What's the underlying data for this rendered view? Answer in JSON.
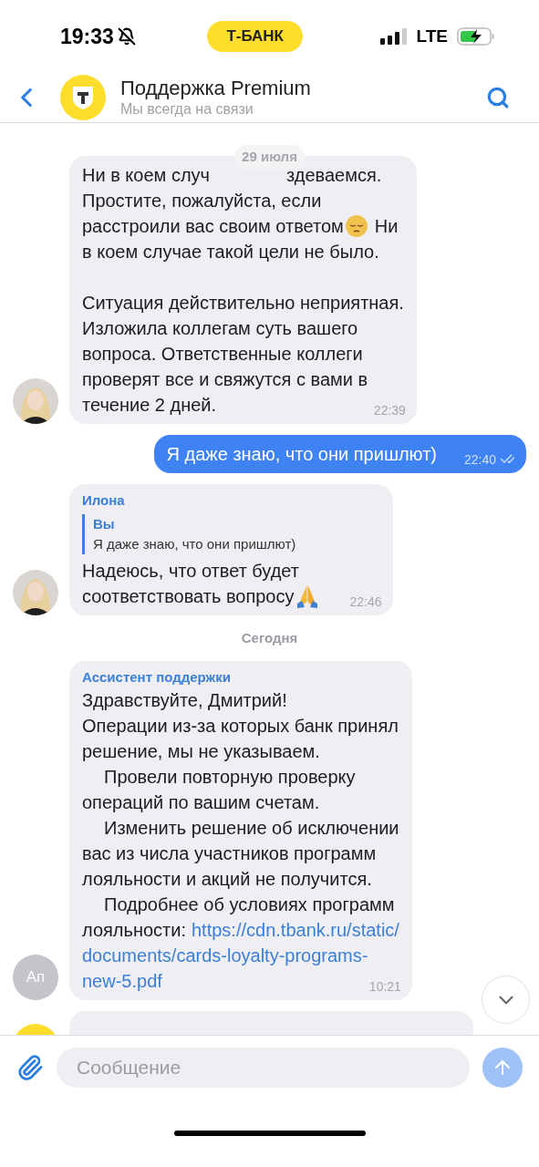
{
  "status_bar": {
    "time": "19:33",
    "carrier_badge": "Т-БАНК",
    "network": "LTE"
  },
  "header": {
    "title": "Поддержка Premium",
    "subtitle": "Мы всегда на связи"
  },
  "sticky_date": "29 июля",
  "messages": [
    {
      "kind": "incoming",
      "avatar": {
        "kind": "photo"
      },
      "time": "22:39",
      "paragraphs": [
        [
          {
            "indent": false,
            "segments": [
              {
                "kind": "text",
                "text": "Ни в коем случ"
              },
              {
                "kind": "covered"
              },
              {
                "kind": "text",
                "text": "здеваемся."
              }
            ]
          },
          {
            "indent": false,
            "segments": [
              {
                "kind": "text",
                "text": "Простите, пожалуйста, если"
              }
            ]
          },
          {
            "indent": false,
            "segments": [
              {
                "kind": "text",
                "text": "расстроили вас своим ответом"
              },
              {
                "kind": "emoji_pensive"
              },
              {
                "kind": "text",
                "text": "Ни"
              }
            ]
          },
          {
            "indent": false,
            "segments": [
              {
                "kind": "text",
                "text": "в коем случае такой цели не было."
              }
            ]
          }
        ],
        [
          {
            "indent": false,
            "segments": [
              {
                "kind": "text",
                "text": "Ситуация действительно неприятная."
              }
            ]
          },
          {
            "indent": false,
            "segments": [
              {
                "kind": "text",
                "text": "Изложила коллегам суть вашего"
              }
            ]
          },
          {
            "indent": false,
            "segments": [
              {
                "kind": "text",
                "text": "вопроса. Ответственные коллеги"
              }
            ]
          },
          {
            "indent": false,
            "segments": [
              {
                "kind": "text",
                "text": "проверят все и свяжутся с вами в"
              }
            ]
          },
          {
            "indent": false,
            "segments": [
              {
                "kind": "text",
                "text": "течение 2 дней."
              }
            ]
          }
        ]
      ]
    },
    {
      "kind": "outgoing",
      "time": "22:40",
      "read": true,
      "paragraphs": [
        [
          {
            "indent": false,
            "segments": [
              {
                "kind": "text",
                "text": "Я даже знаю, что они пришлют)"
              }
            ]
          }
        ]
      ]
    },
    {
      "kind": "incoming",
      "avatar": {
        "kind": "photo"
      },
      "sender": "Илона",
      "reply": {
        "author": "Вы",
        "text": "Я даже знаю, что они пришлют)"
      },
      "time": "22:46",
      "paragraphs": [
        [
          {
            "indent": false,
            "segments": [
              {
                "kind": "text",
                "text": "Надеюсь, что ответ будет"
              }
            ]
          },
          {
            "indent": false,
            "segments": [
              {
                "kind": "text",
                "text": "соответствовать вопросу"
              },
              {
                "kind": "emoji_pray"
              }
            ]
          }
        ]
      ]
    },
    {
      "kind": "date_divider",
      "text": "Сегодня"
    },
    {
      "kind": "incoming",
      "avatar": {
        "kind": "initials",
        "text": "Ап"
      },
      "sender": "Ассистент поддержки",
      "time": "10:21",
      "paragraphs": [
        [
          {
            "indent": false,
            "segments": [
              {
                "kind": "text",
                "text": "Здравствуйте, Дмитрий!"
              }
            ]
          },
          {
            "indent": false,
            "segments": [
              {
                "kind": "text",
                "text": "Операции из-за которых банк принял"
              }
            ]
          },
          {
            "indent": false,
            "segments": [
              {
                "kind": "text",
                "text": "решение, мы не указываем."
              }
            ]
          },
          {
            "indent": true,
            "segments": [
              {
                "kind": "text",
                "text": "Провели повторную проверку"
              }
            ]
          },
          {
            "indent": false,
            "segments": [
              {
                "kind": "text",
                "text": "операций по вашим счетам."
              }
            ]
          },
          {
            "indent": true,
            "segments": [
              {
                "kind": "text",
                "text": "Изменить решение об исключении"
              }
            ]
          },
          {
            "indent": false,
            "segments": [
              {
                "kind": "text",
                "text": "вас из числа участников программ"
              }
            ]
          },
          {
            "indent": false,
            "segments": [
              {
                "kind": "text",
                "text": "лояльности и акций не получится."
              }
            ]
          },
          {
            "indent": true,
            "segments": [
              {
                "kind": "text",
                "text": "Подробнее об условиях программ"
              }
            ]
          },
          {
            "indent": false,
            "segments": [
              {
                "kind": "text",
                "text": "лояльности:"
              },
              {
                "kind": "link",
                "text": "https://cdn.tbank.ru/static/"
              }
            ]
          },
          {
            "indent": false,
            "segments": [
              {
                "kind": "link",
                "text": "documents/cards-loyalty-programs-"
              }
            ]
          },
          {
            "indent": false,
            "segments": [
              {
                "kind": "link",
                "text": "new-5.pdf"
              }
            ]
          }
        ]
      ]
    },
    {
      "kind": "incoming",
      "avatar": {
        "kind": "logo"
      },
      "partial": true
    }
  ],
  "composer": {
    "placeholder": "Сообщение"
  }
}
